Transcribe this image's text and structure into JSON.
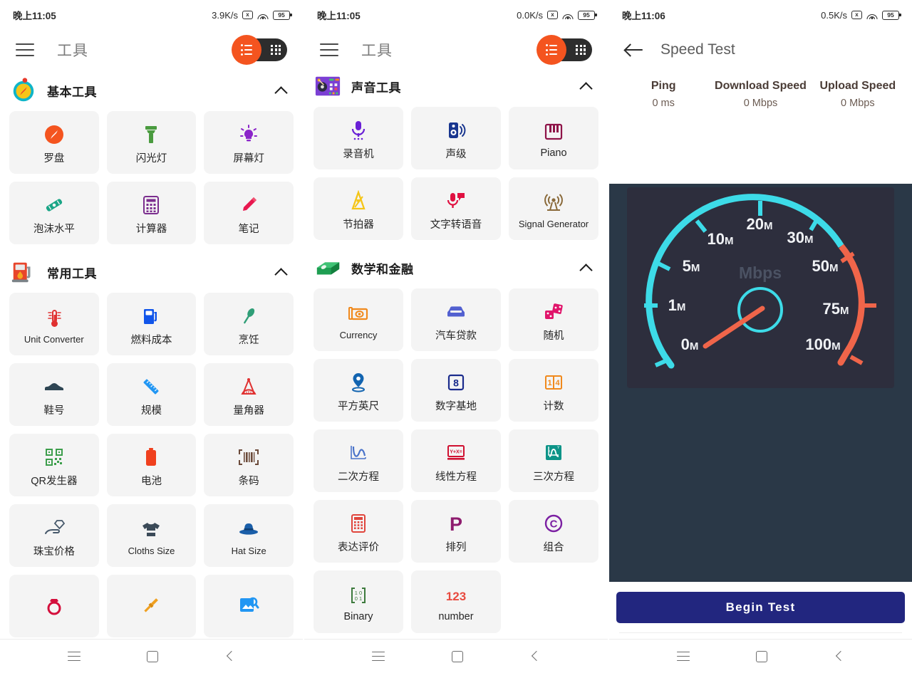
{
  "screens": [
    {
      "status": {
        "time": "晚上11:05",
        "speed": "3.9K/s",
        "battery": "95"
      },
      "appbar": {
        "title": "工具"
      },
      "sections": [
        {
          "icon": "compass-icon",
          "title": "基本工具",
          "tiles": [
            {
              "label": "罗盘",
              "icon": "compass-icon"
            },
            {
              "label": "闪光灯",
              "icon": "flashlight-icon"
            },
            {
              "label": "屏幕灯",
              "icon": "screen-light-icon"
            },
            {
              "label": "泡沫水平",
              "icon": "bubble-level-icon"
            },
            {
              "label": "计算器",
              "icon": "calculator-icon"
            },
            {
              "label": "笔记",
              "icon": "note-pencil-icon"
            }
          ]
        },
        {
          "icon": "fuel-pump-icon",
          "title": "常用工具",
          "tiles": [
            {
              "label": "Unit Converter",
              "icon": "thermometer-icon"
            },
            {
              "label": "燃料成本",
              "icon": "fuel-pump-icon"
            },
            {
              "label": "烹饪",
              "icon": "cooking-spoon-icon"
            },
            {
              "label": "鞋号",
              "icon": "shoe-icon"
            },
            {
              "label": "规模",
              "icon": "ruler-icon"
            },
            {
              "label": "量角器",
              "icon": "protractor-icon"
            },
            {
              "label": "QR发生器",
              "icon": "qr-code-icon"
            },
            {
              "label": "电池",
              "icon": "battery-icon"
            },
            {
              "label": "条码",
              "icon": "barcode-icon"
            },
            {
              "label": "珠宝价格",
              "icon": "gem-hand-icon"
            },
            {
              "label": "Cloths Size",
              "icon": "tshirt-icon"
            },
            {
              "label": "Hat Size",
              "icon": "hat-icon"
            },
            {
              "label": "",
              "icon": "ring-icon"
            },
            {
              "label": "",
              "icon": "screwdriver-icon"
            },
            {
              "label": "",
              "icon": "image-search-icon"
            }
          ]
        }
      ]
    },
    {
      "status": {
        "time": "晚上11:05",
        "speed": "0.0K/s",
        "battery": "95"
      },
      "appbar": {
        "title": "工具"
      },
      "sections": [
        {
          "icon": "dj-mixer-icon",
          "title": "声音工具",
          "tiles": [
            {
              "label": "录音机",
              "icon": "microphone-icon"
            },
            {
              "label": "声级",
              "icon": "speaker-icon"
            },
            {
              "label": "Piano",
              "icon": "piano-icon"
            },
            {
              "label": "节拍器",
              "icon": "metronome-icon"
            },
            {
              "label": "文字转语音",
              "icon": "text-to-speech-icon"
            },
            {
              "label": "Signal Generator",
              "icon": "signal-tower-icon"
            }
          ]
        },
        {
          "icon": "money-stack-icon",
          "title": "数学和金融",
          "tiles": [
            {
              "label": "Currency",
              "icon": "banknote-icon"
            },
            {
              "label": "汽车贷款",
              "icon": "car-icon"
            },
            {
              "label": "随机",
              "icon": "dice-icon"
            },
            {
              "label": "平方英尺",
              "icon": "location-pin-icon"
            },
            {
              "label": "数字基地",
              "icon": "number-base-icon"
            },
            {
              "label": "计数",
              "icon": "counter-icon"
            },
            {
              "label": "二次方程",
              "icon": "parabola-icon"
            },
            {
              "label": "线性方程",
              "icon": "linear-equation-icon"
            },
            {
              "label": "三次方程",
              "icon": "cubic-equation-icon"
            },
            {
              "label": "表达评价",
              "icon": "calculator-icon"
            },
            {
              "label": "排列",
              "icon": "permutation-icon"
            },
            {
              "label": "组合",
              "icon": "combination-icon"
            },
            {
              "label": "Binary",
              "icon": "matrix-icon"
            },
            {
              "label": "number",
              "icon": "number-123-icon"
            }
          ]
        }
      ]
    }
  ],
  "speed_test": {
    "status": {
      "time": "晚上11:06",
      "speed": "0.5K/s",
      "battery": "95"
    },
    "title": "Speed Test",
    "stats": [
      {
        "label": "Ping",
        "value": "0 ms"
      },
      {
        "label": "Download Speed",
        "value": "0 Mbps"
      },
      {
        "label": "Upload Speed",
        "value": "0 Mbps"
      }
    ],
    "gauge": {
      "unit": "Mbps",
      "ticks": [
        "0M",
        "1M",
        "5M",
        "10M",
        "20M",
        "30M",
        "50M",
        "75M",
        "100M"
      ],
      "needle_value": "0",
      "arc_color_low": "#3ddbe8",
      "arc_color_high": "#f0654a"
    },
    "begin_label": "Begin Test"
  },
  "colors": {
    "accent": "#f4541f",
    "toggle_bg": "#2d2d2d",
    "tile_bg": "#f4f4f4",
    "dark_panel": "#2a3847",
    "button": "#22267f"
  }
}
